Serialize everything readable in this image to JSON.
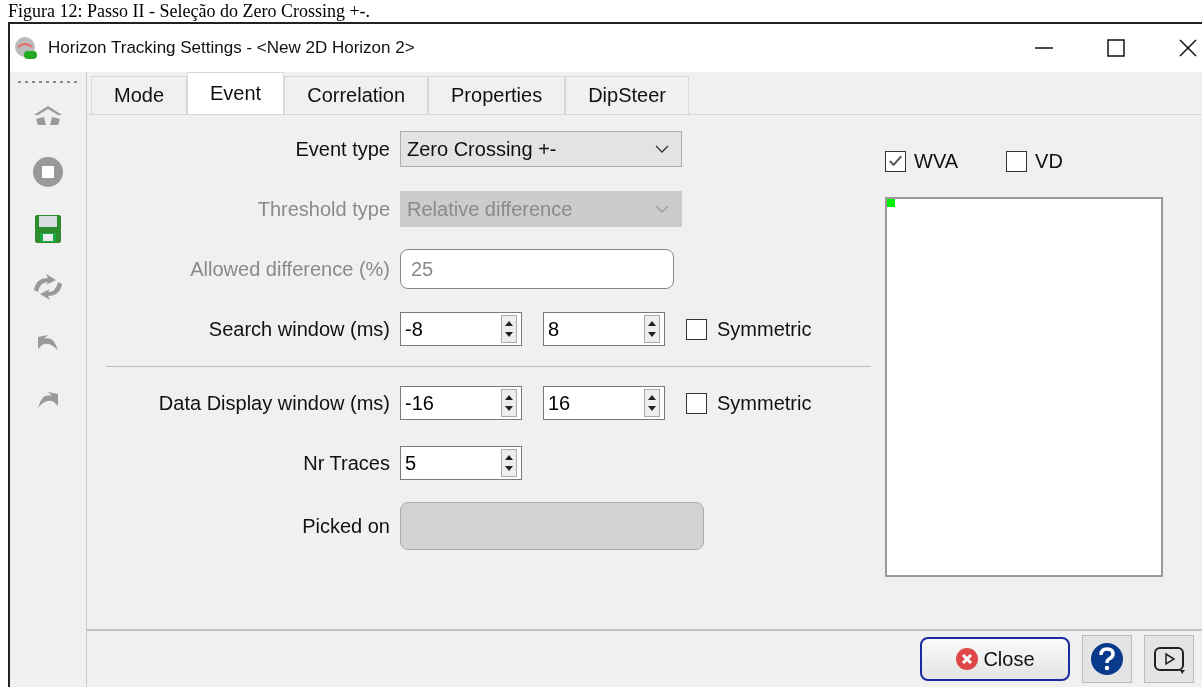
{
  "caption": "Figura 12: Passo II - Seleção do Zero Crossing +-.",
  "window": {
    "title": "Horizon Tracking Settings - <New 2D Horizon 2>"
  },
  "toolbar": [
    {
      "kind": "track",
      "disabled": true
    },
    {
      "kind": "stop",
      "disabled": true
    },
    {
      "kind": "save",
      "disabled": false
    },
    {
      "kind": "retrack",
      "disabled": true
    },
    {
      "kind": "undo",
      "disabled": true
    },
    {
      "kind": "redo",
      "disabled": true
    }
  ],
  "tabs": [
    {
      "label": "Mode",
      "selected": false
    },
    {
      "label": "Event",
      "selected": true
    },
    {
      "label": "Correlation",
      "selected": false
    },
    {
      "label": "Properties",
      "selected": false
    },
    {
      "label": "DipSteer",
      "selected": false
    }
  ],
  "form": {
    "event_type": {
      "label": "Event type",
      "value": "Zero Crossing +-",
      "disabled": false
    },
    "threshold_type": {
      "label": "Threshold type",
      "value": "Relative difference",
      "disabled": true
    },
    "allowed_difference": {
      "label": "Allowed difference (%)",
      "value": "25",
      "disabled": true
    },
    "search_window": {
      "label": "Search window (ms)",
      "from": "-8",
      "to": "8",
      "symmetric": {
        "label": "Symmetric",
        "checked": false
      }
    },
    "data_display_window": {
      "label": "Data Display window (ms)",
      "from": "-16",
      "to": "16",
      "symmetric": {
        "label": "Symmetric",
        "checked": false
      }
    },
    "nr_traces": {
      "label": "Nr Traces",
      "value": "5"
    },
    "picked_on": {
      "label": "Picked on"
    }
  },
  "display": {
    "options": [
      {
        "label": "WVA",
        "checked": true
      },
      {
        "label": "VD",
        "checked": false
      }
    ]
  },
  "buttons": {
    "close": "Close"
  }
}
